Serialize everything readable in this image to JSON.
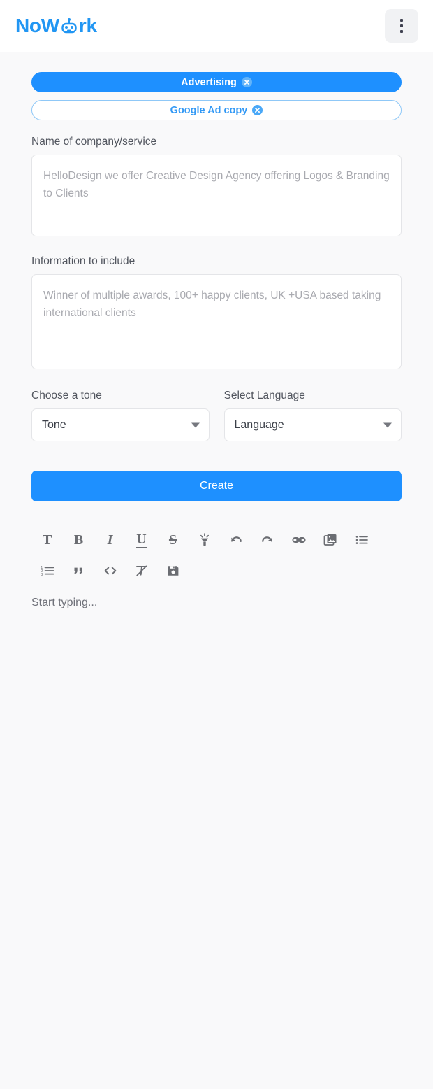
{
  "header": {
    "brand_prefix": "NoW",
    "brand_suffix": "rk",
    "robot_icon": "robot-head-icon",
    "menu_icon": "kebab-menu-icon",
    "brand_color": "#2196f3"
  },
  "tags": [
    {
      "label": "Advertising",
      "style": "primary",
      "close_icon": "close-circle-icon"
    },
    {
      "label": "Google Ad copy",
      "style": "outline",
      "close_icon": "close-circle-icon"
    }
  ],
  "fields": {
    "company": {
      "label": "Name of company/service",
      "placeholder": "HelloDesign we offer Creative Design Agency offering Logos & Branding to Clients",
      "value": ""
    },
    "information": {
      "label": "Information to include",
      "placeholder": "Winner of multiple awards, 100+ happy clients, UK +USA based taking international clients",
      "value": ""
    },
    "tone": {
      "label": "Choose a tone",
      "selected": "Tone",
      "options": [
        "Tone"
      ]
    },
    "language": {
      "label": "Select Language",
      "selected": "Language",
      "options": [
        "Language"
      ]
    }
  },
  "actions": {
    "create_label": "Create",
    "accent_color": "#1e90ff"
  },
  "editor": {
    "toolbar_row_1": [
      {
        "name": "text-icon",
        "title": "Text"
      },
      {
        "name": "bold-icon",
        "title": "Bold"
      },
      {
        "name": "italic-icon",
        "title": "Italic"
      },
      {
        "name": "underline-icon",
        "title": "Underline"
      },
      {
        "name": "strikethrough-icon",
        "title": "Strikethrough"
      },
      {
        "name": "highlighter-icon",
        "title": "Highlight"
      },
      {
        "name": "undo-icon",
        "title": "Undo"
      },
      {
        "name": "redo-icon",
        "title": "Redo"
      },
      {
        "name": "link-icon",
        "title": "Insert link"
      },
      {
        "name": "image-icon",
        "title": "Insert image"
      },
      {
        "name": "bullet-list-icon",
        "title": "Bullet list"
      }
    ],
    "toolbar_row_2": [
      {
        "name": "numbered-list-icon",
        "title": "Numbered list"
      },
      {
        "name": "quote-icon",
        "title": "Quote"
      },
      {
        "name": "code-icon",
        "title": "Code"
      },
      {
        "name": "clear-formatting-icon",
        "title": "Clear formatting"
      },
      {
        "name": "save-icon",
        "title": "Save"
      }
    ],
    "placeholder": "Start typing..."
  }
}
